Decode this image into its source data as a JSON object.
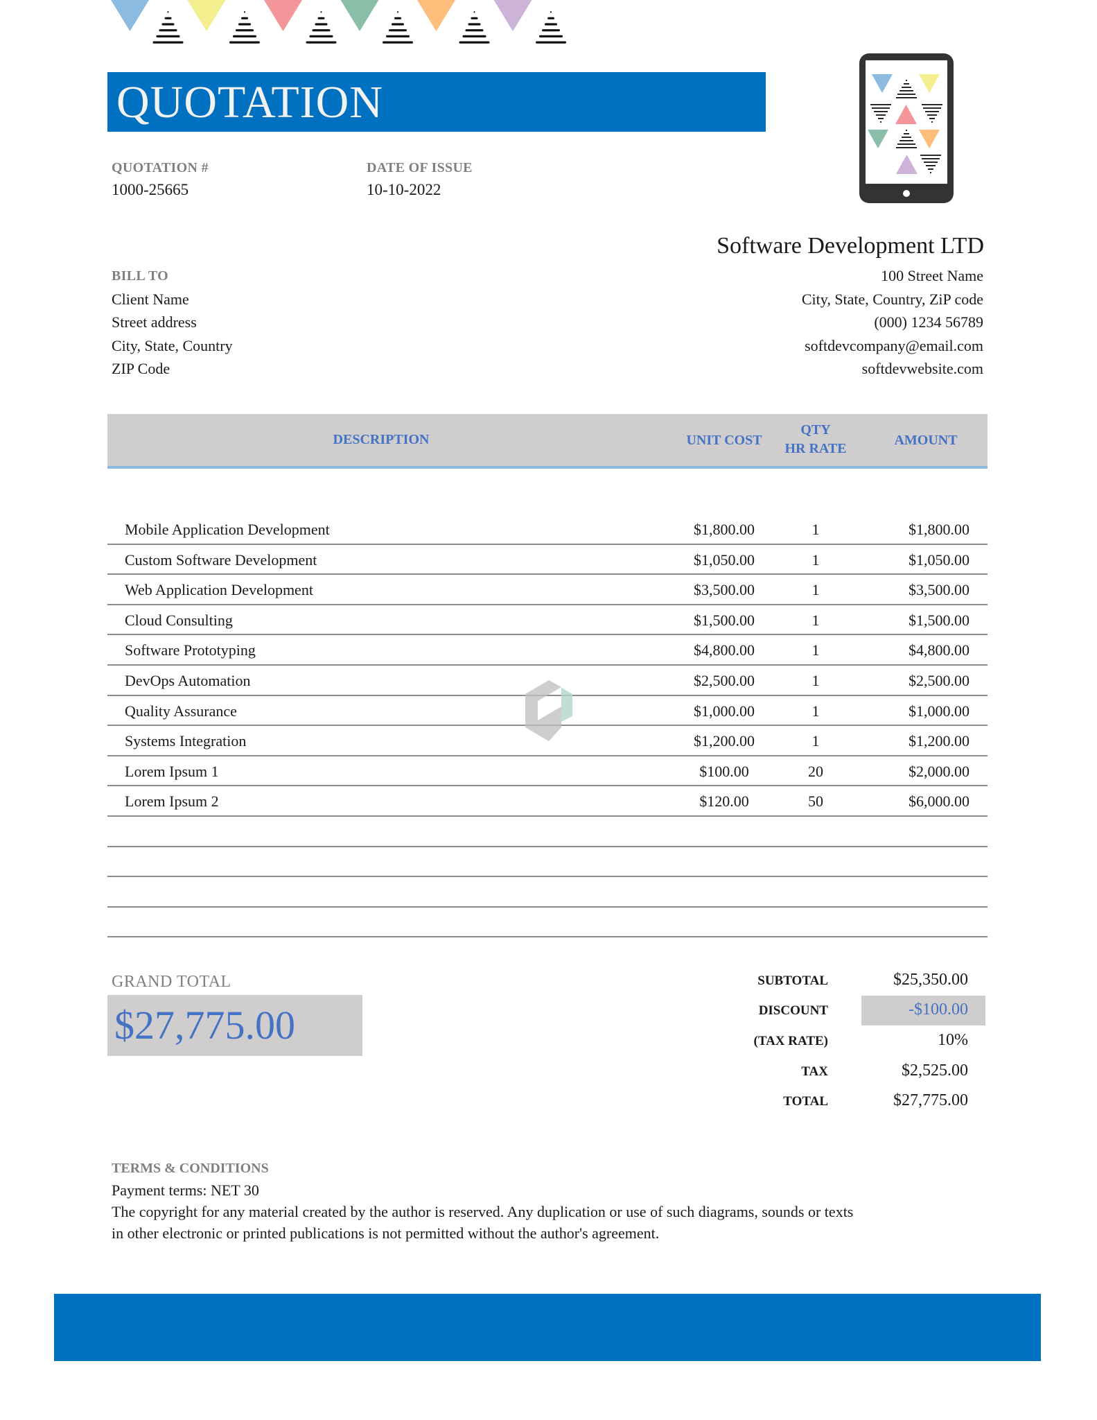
{
  "document": {
    "title": "QUOTATION",
    "brand_color": "#0070C0",
    "accent_text_color": "#4472C4",
    "band_gray": "#CFCDCE"
  },
  "banner": {
    "triangle_colors": [
      "#8BBBE0",
      "#F3EE8E",
      "#F4959A",
      "#8BBEA8",
      "#FDBD7B",
      "#CDB3D8"
    ]
  },
  "meta": {
    "quotation_label": "QUOTATION #",
    "quotation_number": "1000-25665",
    "date_label": "DATE OF ISSUE",
    "date_value": "10-10-2022"
  },
  "company": {
    "name": "Software Development LTD",
    "lines": [
      "100 Street Name",
      "City, State, Country, ZiP code",
      "(000) 1234 56789",
      "softdevcompany@email.com",
      "softdevwebsite.com"
    ]
  },
  "bill_to": {
    "label": "BILL TO",
    "lines": [
      "Client Name",
      "Street address",
      "City, State, Country",
      "ZIP Code"
    ]
  },
  "table": {
    "headers": {
      "description": "DESCRIPTION",
      "unit_cost": "UNIT COST",
      "qty_line1": "QTY",
      "qty_line2": "HR RATE",
      "amount": "AMOUNT"
    },
    "rows": [
      {
        "description": "Mobile Application Development",
        "unit_cost": "$1,800.00",
        "qty": "1",
        "amount": "$1,800.00"
      },
      {
        "description": "Custom Software Development",
        "unit_cost": "$1,050.00",
        "qty": "1",
        "amount": "$1,050.00"
      },
      {
        "description": "Web Application Development",
        "unit_cost": "$3,500.00",
        "qty": "1",
        "amount": "$3,500.00"
      },
      {
        "description": "Cloud Consulting",
        "unit_cost": "$1,500.00",
        "qty": "1",
        "amount": "$1,500.00"
      },
      {
        "description": "Software Prototyping",
        "unit_cost": "$4,800.00",
        "qty": "1",
        "amount": "$4,800.00"
      },
      {
        "description": "DevOps Automation",
        "unit_cost": "$2,500.00",
        "qty": "1",
        "amount": "$2,500.00"
      },
      {
        "description": "Quality Assurance",
        "unit_cost": "$1,000.00",
        "qty": "1",
        "amount": "$1,000.00"
      },
      {
        "description": "Systems Integration",
        "unit_cost": "$1,200.00",
        "qty": "1",
        "amount": "$1,200.00"
      },
      {
        "description": "Lorem Ipsum 1",
        "unit_cost": "$100.00",
        "qty": "20",
        "amount": "$2,000.00"
      },
      {
        "description": "Lorem Ipsum 2",
        "unit_cost": "$120.00",
        "qty": "50",
        "amount": "$6,000.00"
      },
      {
        "description": "",
        "unit_cost": "",
        "qty": "",
        "amount": ""
      },
      {
        "description": "",
        "unit_cost": "",
        "qty": "",
        "amount": ""
      },
      {
        "description": "",
        "unit_cost": "",
        "qty": "",
        "amount": ""
      },
      {
        "description": "",
        "unit_cost": "",
        "qty": "",
        "amount": ""
      }
    ]
  },
  "grand_total": {
    "label": "GRAND TOTAL",
    "value": "$27,775.00"
  },
  "summary": {
    "subtotal_label": "SUBTOTAL",
    "subtotal_value": "$25,350.00",
    "discount_label": "DISCOUNT",
    "discount_value": "-$100.00",
    "tax_rate_label": "(TAX RATE)",
    "tax_rate_value": "10%",
    "tax_label": "TAX",
    "tax_value": "$2,525.00",
    "total_label": "TOTAL",
    "total_value": "$27,775.00"
  },
  "terms": {
    "label": "TERMS & CONDITIONS",
    "lines": [
      "Payment terms: NET 30",
      "The copyright for any material created by the author is reserved. Any duplication or use of such diagrams, sounds or texts",
      "in other electronic or printed publications is not permitted without the author's agreement."
    ]
  }
}
